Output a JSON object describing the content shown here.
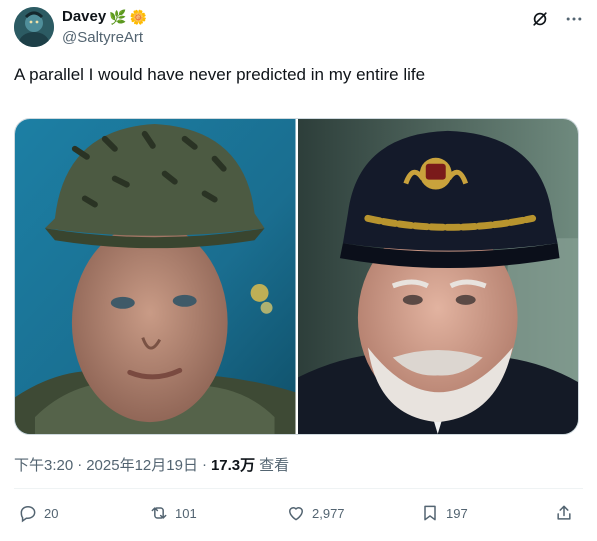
{
  "author": {
    "display_name": "Davey",
    "name_emojis": [
      "🌿",
      "🌼"
    ],
    "handle": "@SaltyreArt"
  },
  "tweet": {
    "text": "A parallel I would have never predicted in my entire life"
  },
  "media": [
    {
      "description_name": "photo-left"
    },
    {
      "description_name": "photo-right"
    }
  ],
  "meta": {
    "time": "下午3:20",
    "separator": "·",
    "date": "2025年12月19日",
    "views_count": "17.3万",
    "views_label": "查看"
  },
  "actions": {
    "replies": "20",
    "retweets": "101",
    "likes": "2,977",
    "bookmarks": "197"
  },
  "icons": {
    "grok": "grok-icon",
    "more": "more-icon",
    "reply": "reply-icon",
    "retweet": "retweet-icon",
    "like": "heart-icon",
    "bookmark": "bookmark-icon",
    "share": "share-icon"
  },
  "colors": {
    "text_primary": "#0f1419",
    "text_secondary": "#536471",
    "border": "#cfd9de"
  }
}
